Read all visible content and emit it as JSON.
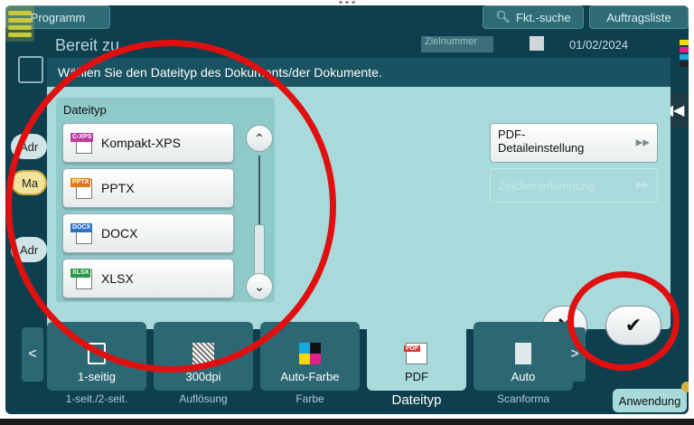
{
  "top_bar": {
    "program_label": "Programm",
    "search_label": "Fkt.-suche",
    "list_label": "Auftragsliste"
  },
  "background": {
    "title": "Bereit zu...",
    "target_number_placeholder": "Zielnummer",
    "date": "01/02/2024",
    "side_pills": [
      "Adr",
      "Ma",
      "Adr"
    ]
  },
  "dialog": {
    "header": "Wählen Sie den Dateityp des Dokuments/der Dokumente.",
    "file_type_section_label": "Dateityp",
    "file_types": [
      {
        "label": "Kompakt-XPS",
        "tag": "C-XPS",
        "tag_color": "#c03aa0"
      },
      {
        "label": "PPTX",
        "tag": "PPTX",
        "tag_color": "#e07a1e"
      },
      {
        "label": "DOCX",
        "tag": "DOCX",
        "tag_color": "#2a73c9"
      },
      {
        "label": "XLSX",
        "tag": "XLSX",
        "tag_color": "#2a9a4a"
      }
    ],
    "pdf_detail_label_line1": "PDF-",
    "pdf_detail_label_line2": "Detaileinstellung",
    "ocr_label": "Zeichenerkennung",
    "cancel_symbol": "✕",
    "ok_symbol": "✔",
    "collapse_symbol": "◀◀"
  },
  "toolbar": {
    "items": [
      {
        "value": "1-seitig",
        "label": "1-seit./2-seit."
      },
      {
        "value": "300dpi",
        "label": "Auflösung"
      },
      {
        "value": "Auto-Farbe",
        "label": "Farbe"
      },
      {
        "value": "PDF",
        "label": "Dateityp"
      },
      {
        "value": "Auto",
        "label": "Scanforma"
      }
    ],
    "apply_label": "Anwendung",
    "prev_symbol": "<",
    "next_symbol": ">"
  },
  "colors": {
    "background": "#0e3f4f",
    "dialog_bg": "#a8dadb",
    "dialog_header": "#195261",
    "annotation_red": "#e01010"
  }
}
